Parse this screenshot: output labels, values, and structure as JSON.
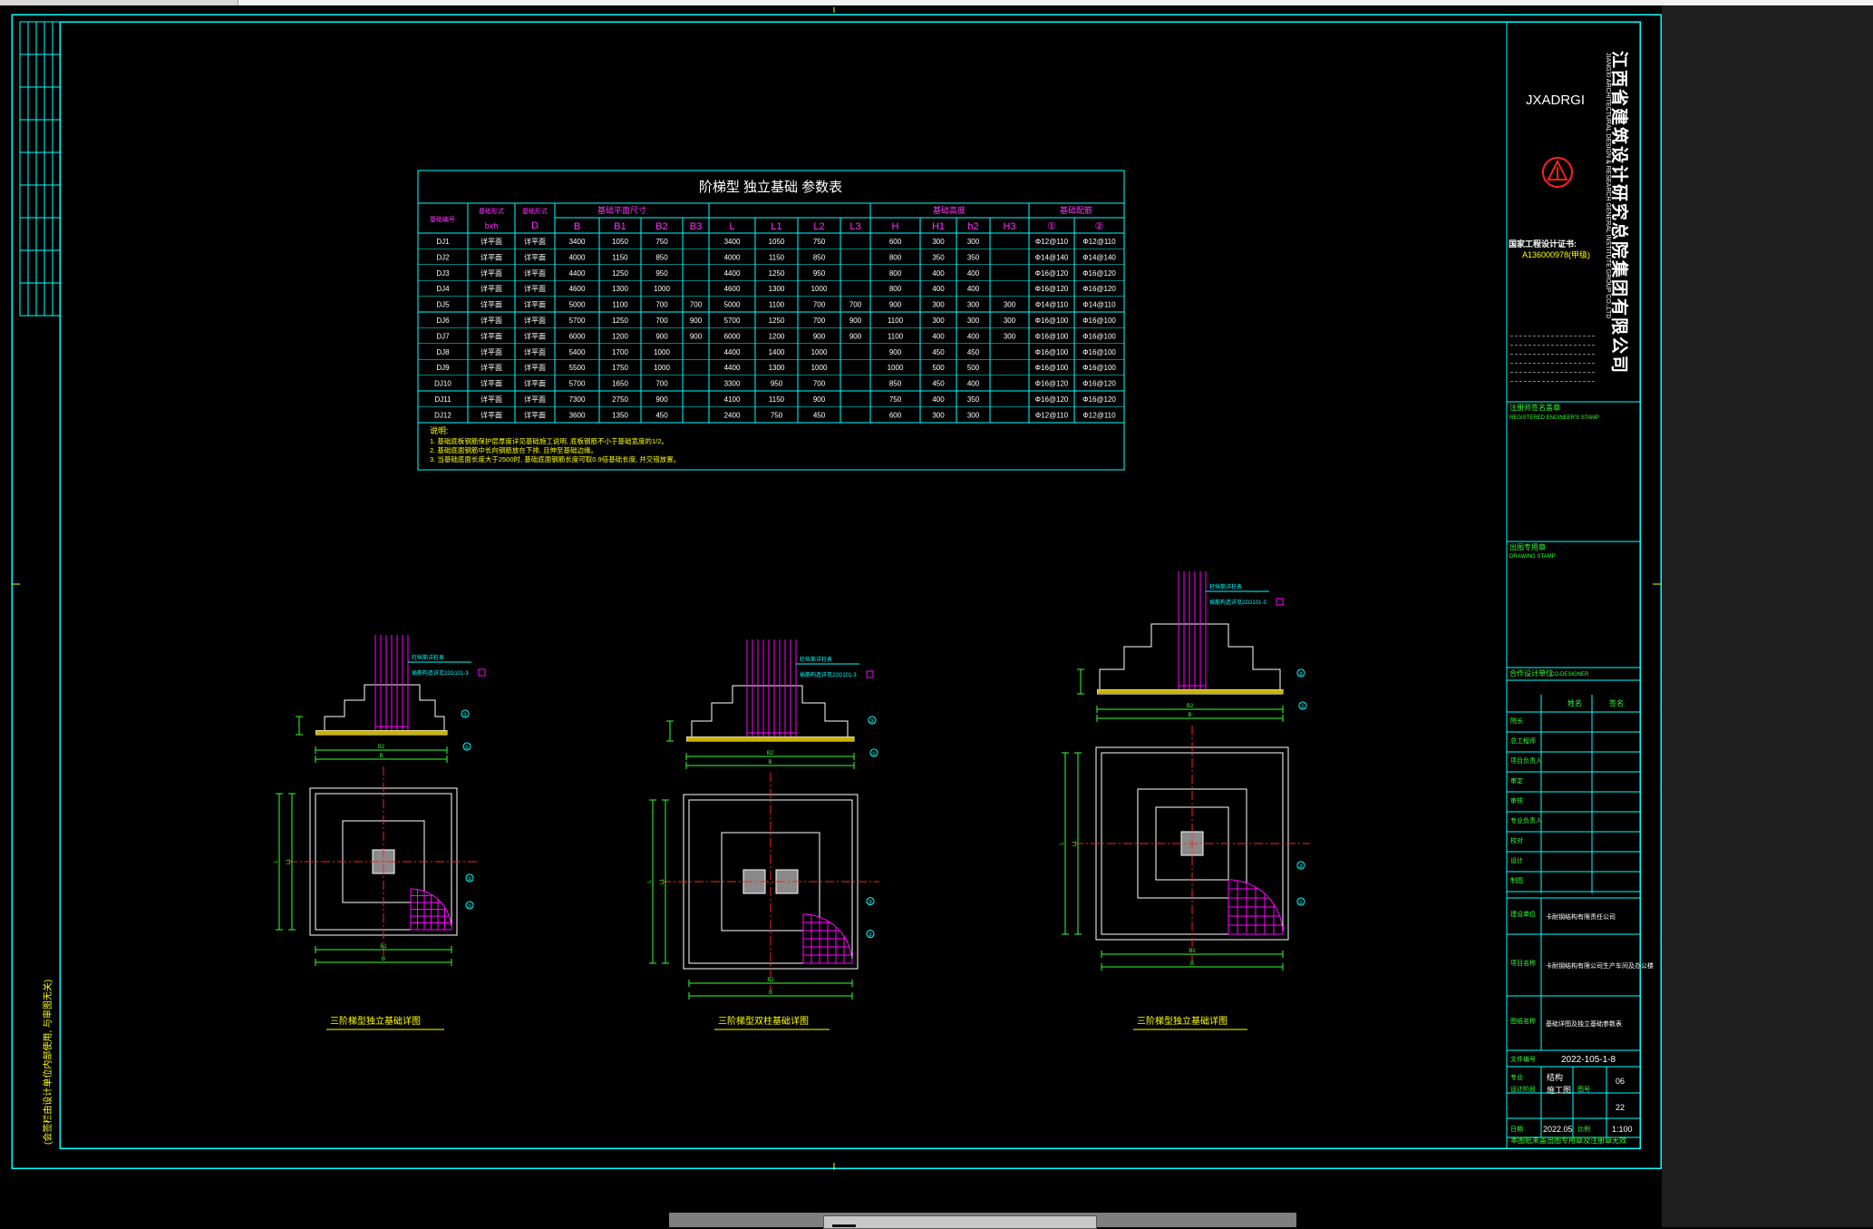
{
  "company": {
    "name_cn": "江西省建筑设计研究总院集团有限公司",
    "name_en": "JIANGXI ARCHITECTURAL DESIGN & RESEARCH GENERAL INSTITUTE GROUP CO.,LTD",
    "logo_text": "JXADRGI",
    "license_label": "国家工程设计证书:",
    "license_no": "A136000978(甲级)"
  },
  "table": {
    "title": "阶梯型 独立基础 参数表",
    "group_plan": "基础平面尺寸",
    "group_height": "基础高度",
    "group_rebar": "基础配筋",
    "col_foundation": "基础编号",
    "col_type": "基础形式",
    "col_type_sub": "bxh",
    "col_d": "D",
    "col_b": "B",
    "col_b1": "B1",
    "col_b2": "B2",
    "col_b3": "B3",
    "col_l": "L",
    "col_l1": "L1",
    "col_l2": "L2",
    "col_l3": "L3",
    "col_h": "H",
    "col_h1": "H1",
    "col_h2": "h2",
    "col_h3": "H3",
    "col_r1": "①",
    "col_r2": "②",
    "rows": [
      [
        "DJ1",
        "详平面",
        "详平面",
        "3400",
        "1050",
        "750",
        "",
        "3400",
        "1050",
        "750",
        "",
        "600",
        "300",
        "300",
        "",
        "Φ12@110",
        "Φ12@110"
      ],
      [
        "DJ2",
        "详平面",
        "详平面",
        "4000",
        "1150",
        "850",
        "",
        "4000",
        "1150",
        "850",
        "",
        "800",
        "350",
        "350",
        "",
        "Φ14@140",
        "Φ14@140"
      ],
      [
        "DJ3",
        "详平面",
        "详平面",
        "4400",
        "1250",
        "950",
        "",
        "4400",
        "1250",
        "950",
        "",
        "800",
        "400",
        "400",
        "",
        "Φ16@120",
        "Φ16@120"
      ],
      [
        "DJ4",
        "详平面",
        "详平面",
        "4600",
        "1300",
        "1000",
        "",
        "4600",
        "1300",
        "1000",
        "",
        "800",
        "400",
        "400",
        "",
        "Φ16@120",
        "Φ16@120"
      ],
      [
        "DJ5",
        "详平面",
        "详平面",
        "5000",
        "1100",
        "700",
        "700",
        "5000",
        "1100",
        "700",
        "700",
        "900",
        "300",
        "300",
        "300",
        "Φ14@110",
        "Φ14@110"
      ],
      [
        "DJ6",
        "详平面",
        "详平面",
        "5700",
        "1250",
        "700",
        "900",
        "5700",
        "1250",
        "700",
        "900",
        "1100",
        "300",
        "300",
        "300",
        "Φ16@100",
        "Φ16@100"
      ],
      [
        "DJ7",
        "详平面",
        "详平面",
        "6000",
        "1200",
        "900",
        "900",
        "6000",
        "1200",
        "900",
        "900",
        "1100",
        "400",
        "400",
        "300",
        "Φ16@100",
        "Φ16@100"
      ],
      [
        "DJ8",
        "详平面",
        "详平面",
        "5400",
        "1700",
        "1000",
        "",
        "4400",
        "1400",
        "1000",
        "",
        "900",
        "450",
        "450",
        "",
        "Φ16@100",
        "Φ16@100"
      ],
      [
        "DJ9",
        "详平面",
        "详平面",
        "5500",
        "1750",
        "1000",
        "",
        "4400",
        "1300",
        "1000",
        "",
        "1000",
        "500",
        "500",
        "",
        "Φ16@100",
        "Φ16@100"
      ],
      [
        "DJ10",
        "详平面",
        "详平面",
        "5700",
        "1650",
        "700",
        "",
        "3300",
        "950",
        "700",
        "",
        "850",
        "450",
        "400",
        "",
        "Φ16@120",
        "Φ16@120"
      ],
      [
        "DJ11",
        "详平面",
        "详平面",
        "7300",
        "2750",
        "900",
        "",
        "4100",
        "1150",
        "900",
        "",
        "750",
        "400",
        "350",
        "",
        "Φ16@120",
        "Φ16@120"
      ],
      [
        "DJ12",
        "详平面",
        "详平面",
        "3600",
        "1350",
        "450",
        "",
        "2400",
        "750",
        "450",
        "",
        "600",
        "300",
        "300",
        "",
        "Φ12@110",
        "Φ12@110"
      ]
    ],
    "notes_title": "说明:",
    "notes": [
      "1. 基础底板钢筋保护层厚度详见基础施工说明, 底板钢筋不小于基础宽度的1/2。",
      "2. 基础底面钢筋中长向钢筋放在下排, 且伸至基础边缘。",
      "3. 当基础底面长度大于2500时, 基础底面钢筋长度可取0.9倍基础长度, 并交错放置。"
    ]
  },
  "details": {
    "caption1": "三阶梯型独立基础详图",
    "caption2": "三阶梯型双柱基础详图",
    "caption3": "三阶梯型独立基础详图",
    "bubble1": "①",
    "bubble2": "②",
    "dim_b": "B",
    "dim_l": "L",
    "dim_b1": "B1",
    "dim_b2": "B2",
    "dim_l1": "L1",
    "dim_l2": "L2",
    "callout_col": "柱纵筋详柱表",
    "callout_stirrup": "插筋箍筋同柱箍筋",
    "callout_pad": "C15素混凝土垫层100厚",
    "callout_base": "基础底标高",
    "callout_dowel": "插筋构造详见22G101-3"
  },
  "titleblock": {
    "reg_label": "注册师签名盖章",
    "reg_label_en": "REGISTERED ENGINEER'S STAMP",
    "cert_label": "出图专用章",
    "cert_label_en": "DRAWING STAMP",
    "coop_label": "合作设计单位",
    "coop_label_en": "CO-DESIGNER",
    "col_name": "姓名",
    "col_sign": "签名",
    "roles": [
      "院长",
      "总工程师",
      "项目负责人",
      "审定",
      "审核",
      "专业负责人",
      "校对",
      "设计",
      "制图"
    ],
    "client_label": "建设单位",
    "client": "卡耐钢结构有限责任公司",
    "project_label": "项目名称",
    "project": "卡耐钢结构有限公司生产车间及办公楼",
    "drawing_label": "图纸名称",
    "drawing": "基础详图及独立基础参数表",
    "file_label": "文件编号",
    "file_no": "2022-105-1-8",
    "disc_label": "专业",
    "disc": "结构",
    "stage_label": "设计阶段",
    "stage": "施工图",
    "sheet_label": "图号",
    "sheet": "06",
    "total": "22",
    "date_label": "日期",
    "date": "2022.05",
    "scale_label": "比例",
    "scale": "1:100",
    "footer": "本图纸未盖出图专用章及注册章无效"
  },
  "left_margin_text": "(会签栏由设计单位内部使用, 与审图无关)",
  "colors": {
    "frame": "#00ffff",
    "text": "#ffff00",
    "rebar": "#ff00ff",
    "dim": "#33ff33",
    "axis": "#ff2020",
    "column": "#8a8a8a",
    "pad": "#c8b400",
    "logo": "#ff2020"
  }
}
